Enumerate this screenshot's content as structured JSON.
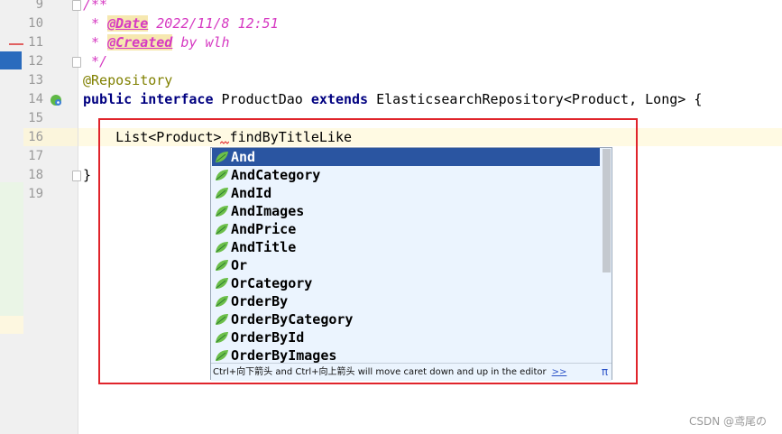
{
  "line_numbers": [
    "9",
    "10",
    "11",
    "12",
    "13",
    "14",
    "15",
    "16",
    "17",
    "18",
    "19"
  ],
  "code": {
    "line9": "/**",
    "line10_prefix": " * ",
    "line10_tag": "@Date",
    "line10_text": " 2022/11/8 12:51",
    "line11_prefix": " * ",
    "line11_tag": "@Created",
    "line11_text": " by wlh",
    "line12": " */",
    "line13": "@Repository",
    "line14_kw1": "public",
    "line14_kw2": "interface",
    "line14_name": "ProductDao",
    "line14_kw3": "extends",
    "line14_rest": "ElasticsearchRepository<Product, Long> {",
    "line16": "    List<Product> findByTitleLike",
    "line18": "}"
  },
  "completion": {
    "items": [
      "And",
      "AndCategory",
      "AndId",
      "AndImages",
      "AndPrice",
      "AndTitle",
      "Or",
      "OrCategory",
      "OrderBy",
      "OrderByCategory",
      "OrderById",
      "OrderByImages"
    ],
    "selected_index": 0,
    "hint": "Ctrl+向下箭头 and Ctrl+向上箭头 will move caret down and up in the editor",
    "more_link": ">>",
    "pi_symbol": "π"
  },
  "colors": {
    "highlight_box": "#e0242b",
    "selected_item": "#2a55a1",
    "comment": "#d63ac2",
    "keyword": "#000080"
  },
  "icons": {
    "completion_item": "spring-leaf-icon",
    "gutter": "spring-bean-icon"
  },
  "watermark": "CSDN @鸢尾の"
}
